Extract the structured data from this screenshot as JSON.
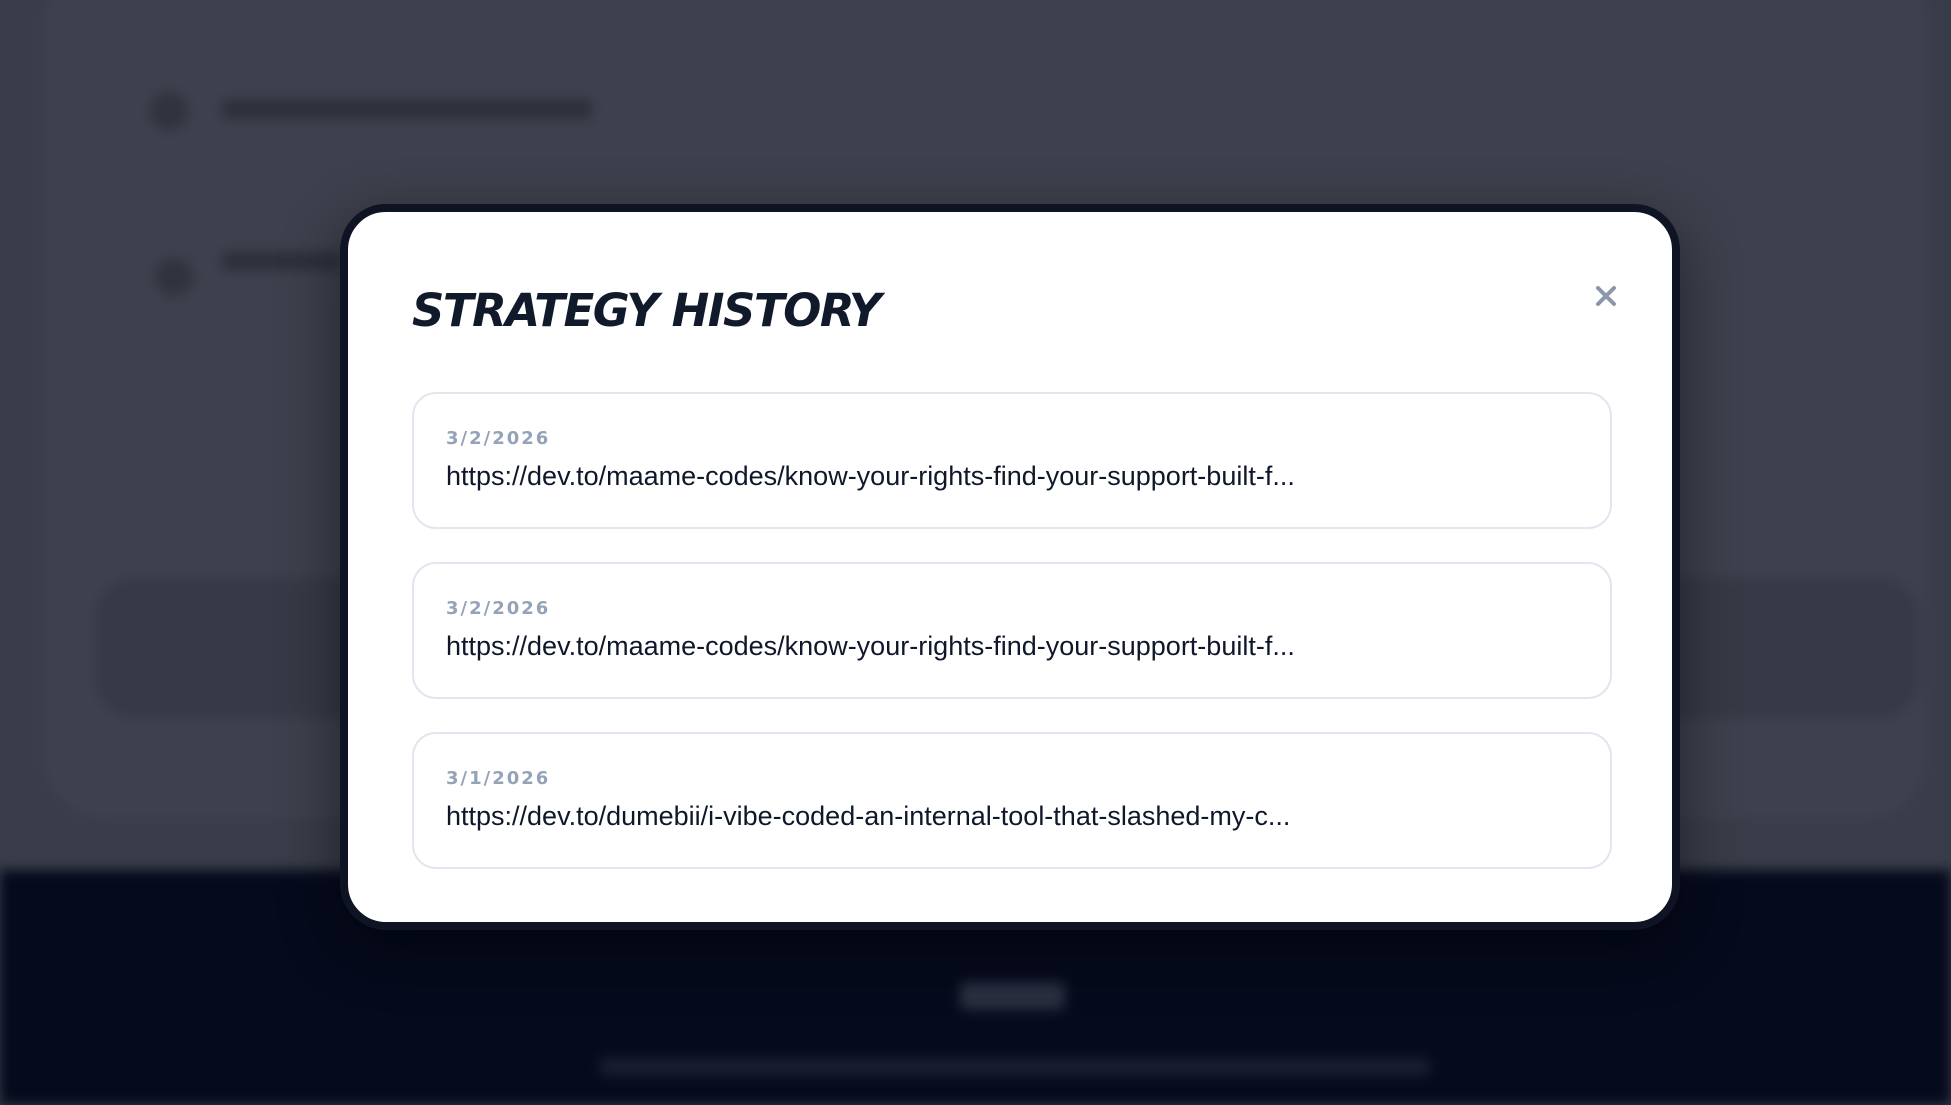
{
  "modal": {
    "title": "STRATEGY HISTORY",
    "close_icon": "close-icon",
    "items": [
      {
        "date": "3/2/2026",
        "url": "https://dev.to/maame-codes/know-your-rights-find-your-support-built-f..."
      },
      {
        "date": "3/2/2026",
        "url": "https://dev.to/maame-codes/know-your-rights-find-your-support-built-f..."
      },
      {
        "date": "3/1/2026",
        "url": "https://dev.to/dumebii/i-vibe-coded-an-internal-tool-that-slashed-my-c..."
      }
    ]
  },
  "colors": {
    "overlay": "#383c48",
    "modal_border": "#0e1423",
    "title": "#111a2b",
    "date": "#94a3b8",
    "url": "#0f172a",
    "item_border": "#e2e6ee",
    "close": "#8a97ab",
    "footer": "#050a1c"
  }
}
